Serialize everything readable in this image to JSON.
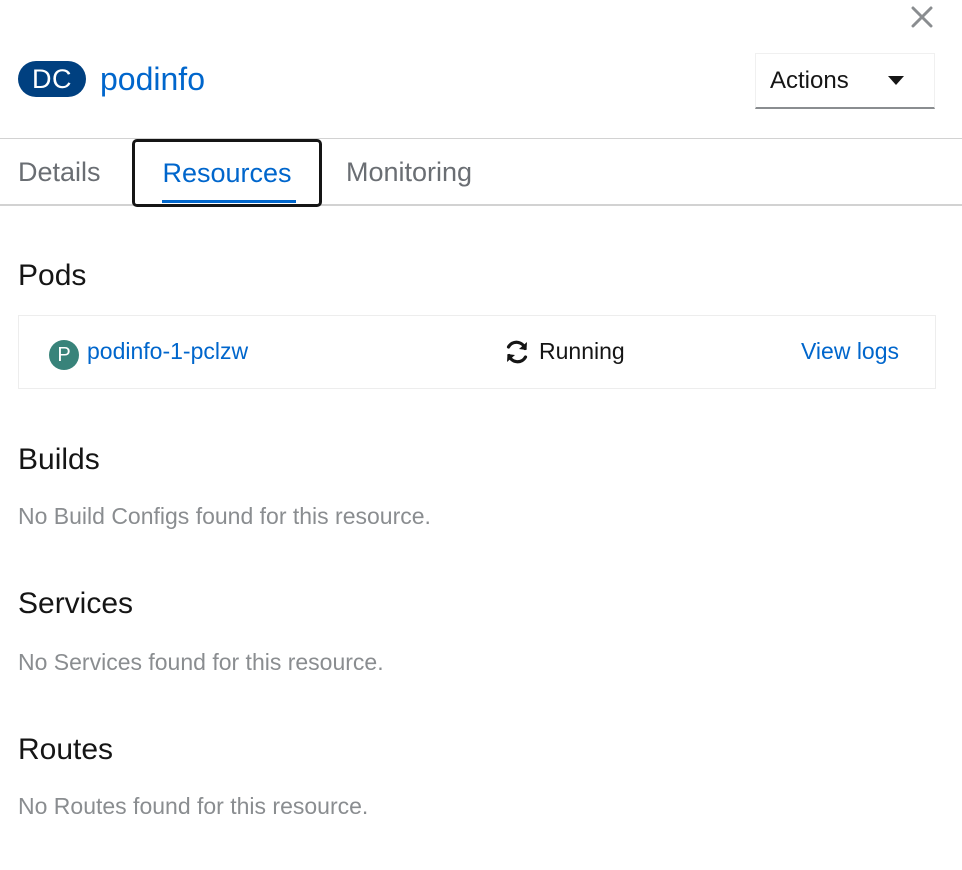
{
  "header": {
    "badge": "DC",
    "title": "podinfo",
    "actions_label": "Actions"
  },
  "tabs": [
    {
      "label": "Details",
      "active": false
    },
    {
      "label": "Resources",
      "active": true
    },
    {
      "label": "Monitoring",
      "active": false
    }
  ],
  "pods": {
    "title": "Pods",
    "items": [
      {
        "badge": "P",
        "name": "podinfo-1-pclzw",
        "status": "Running",
        "link": "View logs"
      }
    ]
  },
  "builds": {
    "title": "Builds",
    "empty": "No Build Configs found for this resource."
  },
  "services": {
    "title": "Services",
    "empty": "No Services found for this resource."
  },
  "routes": {
    "title": "Routes",
    "empty": "No Routes found for this resource."
  },
  "colors": {
    "link": "#0066cc",
    "badge_dc": "#004080",
    "badge_pod": "#38837a",
    "muted_text": "#8a8d90"
  }
}
